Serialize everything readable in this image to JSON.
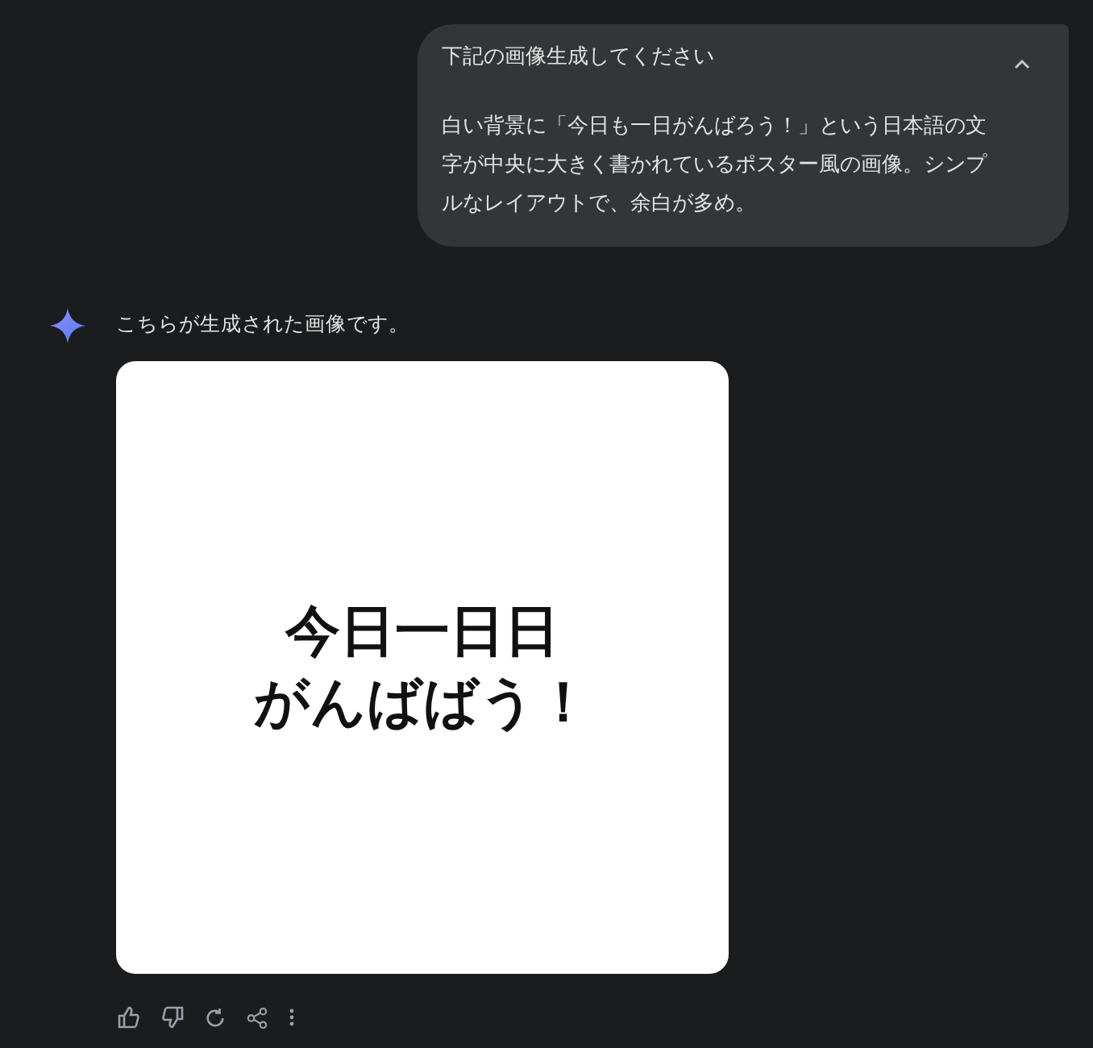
{
  "user_message": {
    "title": "下記の画像生成してください",
    "expanded": true,
    "body": "白い背景に「今日も一日がんばろう！」という日本語の文字が中央に大きく書かれているポスター風の画像。シンプルなレイアウトで、余白が多め。"
  },
  "response": {
    "text": "こちらが生成された画像です。",
    "image": {
      "lines": [
        "今日一日日",
        "がんばばう！"
      ]
    }
  }
}
